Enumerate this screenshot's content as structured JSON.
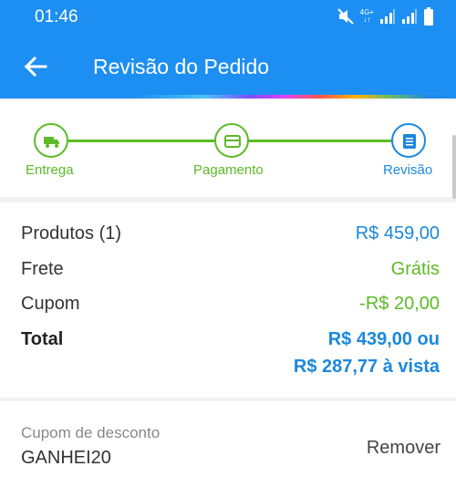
{
  "status_bar": {
    "time": "01:46",
    "network": "4G+"
  },
  "header": {
    "title": "Revisão do Pedido",
    "back_icon": "arrow-left-icon"
  },
  "stepper": {
    "steps": [
      {
        "label": "Entrega",
        "icon": "truck-icon",
        "state": "done"
      },
      {
        "label": "Pagamento",
        "icon": "credit-card-icon",
        "state": "done"
      },
      {
        "label": "Revisão",
        "icon": "list-icon",
        "state": "current"
      }
    ],
    "colors": {
      "done": "#5cba26",
      "current": "#1b88dc"
    }
  },
  "summary": {
    "products": {
      "label": "Produtos (1)",
      "value": "R$ 459,00"
    },
    "shipping": {
      "label": "Frete",
      "value": "Grátis"
    },
    "coupon": {
      "label": "Cupom",
      "value": "-R$ 20,00"
    },
    "total": {
      "label": "Total",
      "value_line1": "R$ 439,00 ou",
      "value_line2": "R$ 287,77 à vista"
    }
  },
  "coupon_section": {
    "label": "Cupom de desconto",
    "code": "GANHEI20",
    "remove_label": "Remover"
  },
  "colors": {
    "app_bar": "#1d8ff2",
    "accent_blue": "#1b88dc",
    "accent_green": "#5cba26"
  }
}
